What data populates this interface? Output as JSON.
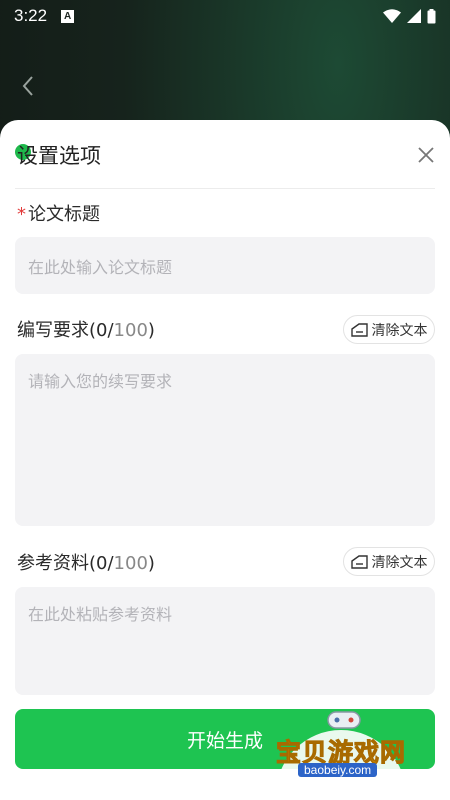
{
  "status_bar": {
    "time": "3:22",
    "notification_letter": "A"
  },
  "sheet": {
    "title": "设置选项"
  },
  "fields": {
    "title": {
      "required_mark": "*",
      "label": "论文标题",
      "placeholder": "在此处输入论文标题"
    },
    "requirements": {
      "label": "编写要求",
      "count_open": "(0/",
      "count_max": "100",
      "count_close": ")",
      "placeholder": "请输入您的续写要求",
      "clear_label": "清除文本"
    },
    "reference": {
      "label": "参考资料",
      "count_open": "(0/",
      "count_max": "100",
      "count_close": ")",
      "placeholder": "在此处粘贴参考资料",
      "clear_label": "清除文本"
    }
  },
  "action": {
    "start_label": "开始生成"
  },
  "watermark": {
    "text": "宝贝游戏网",
    "url": "baobeiy.com"
  },
  "colors": {
    "accent": "#1ec451",
    "required": "#e23a3a",
    "field_bg": "#f3f3f5"
  }
}
